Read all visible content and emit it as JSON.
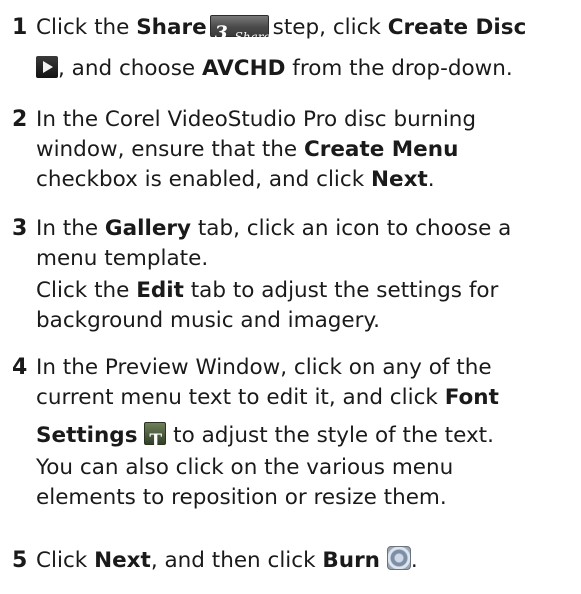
{
  "steps": [
    {
      "number": "1",
      "lines": [
        [
          "Click the ",
          "Share",
          "",
          "step, click ",
          "Create Disc"
        ],
        [
          ", and choose ",
          "AVCHD",
          " from the drop-down."
        ]
      ],
      "share_icon": {
        "num": "3",
        "text": "Share"
      },
      "icons": [
        "share-step-icon",
        "create-disc-icon"
      ]
    },
    {
      "number": "2",
      "text": [
        "In the Corel VideoStudio Pro disc burning",
        "window, ensure that the ",
        "Create Menu",
        "checkbox is enabled, and click ",
        "Next",
        "."
      ]
    },
    {
      "number": "3",
      "text": [
        "In the ",
        "Gallery",
        " tab, click an icon to choose a",
        "menu template.",
        "Click the ",
        "Edit",
        " tab to adjust the settings for",
        "background music and imagery."
      ]
    },
    {
      "number": "4",
      "text": [
        "In the Preview Window, click on any of the",
        "current menu text to edit it, and click ",
        "Font",
        "Settings",
        " to adjust the style of the text.",
        "You can also click on the various menu",
        "elements to reposition or resize them."
      ],
      "icons": [
        "font-settings-icon"
      ]
    },
    {
      "number": "5",
      "text": [
        "Click ",
        "Next",
        ", and then click ",
        "Burn",
        "."
      ],
      "icons": [
        "burn-icon"
      ]
    }
  ]
}
